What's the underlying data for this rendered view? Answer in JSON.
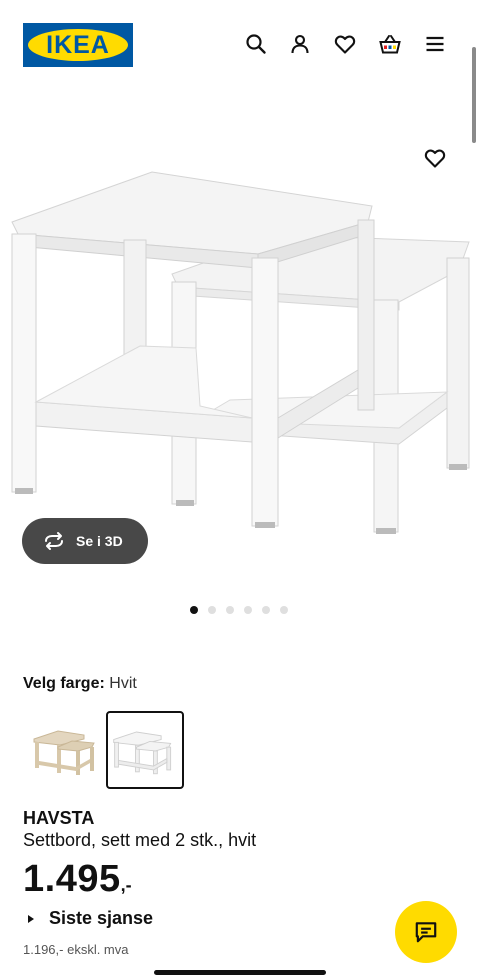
{
  "header": {
    "logo_text": "IKEA",
    "icons": [
      "search-icon",
      "user-icon",
      "heart-icon",
      "shopping-bag-icon",
      "menu-icon"
    ]
  },
  "gallery": {
    "favorite_icon": "heart-icon",
    "view_3d_label": "Se i 3D",
    "page_count": 6,
    "active_page": 1
  },
  "product": {
    "color_label": "Velg farge:",
    "color_value": "Hvit",
    "swatches": [
      {
        "id": "natural",
        "selected": false
      },
      {
        "id": "white",
        "selected": true
      }
    ],
    "name": "HAVSTA",
    "description": "Settbord, sett med 2 stk., hvit",
    "price_main": "1.495",
    "price_suffix": ",-",
    "sale_label": "Siste sjanse",
    "excl_vat": "1.196,- ekskl. mva"
  },
  "colors": {
    "brand_blue": "#0058a3",
    "brand_yellow": "#ffdb00",
    "button_dark": "#484848"
  }
}
